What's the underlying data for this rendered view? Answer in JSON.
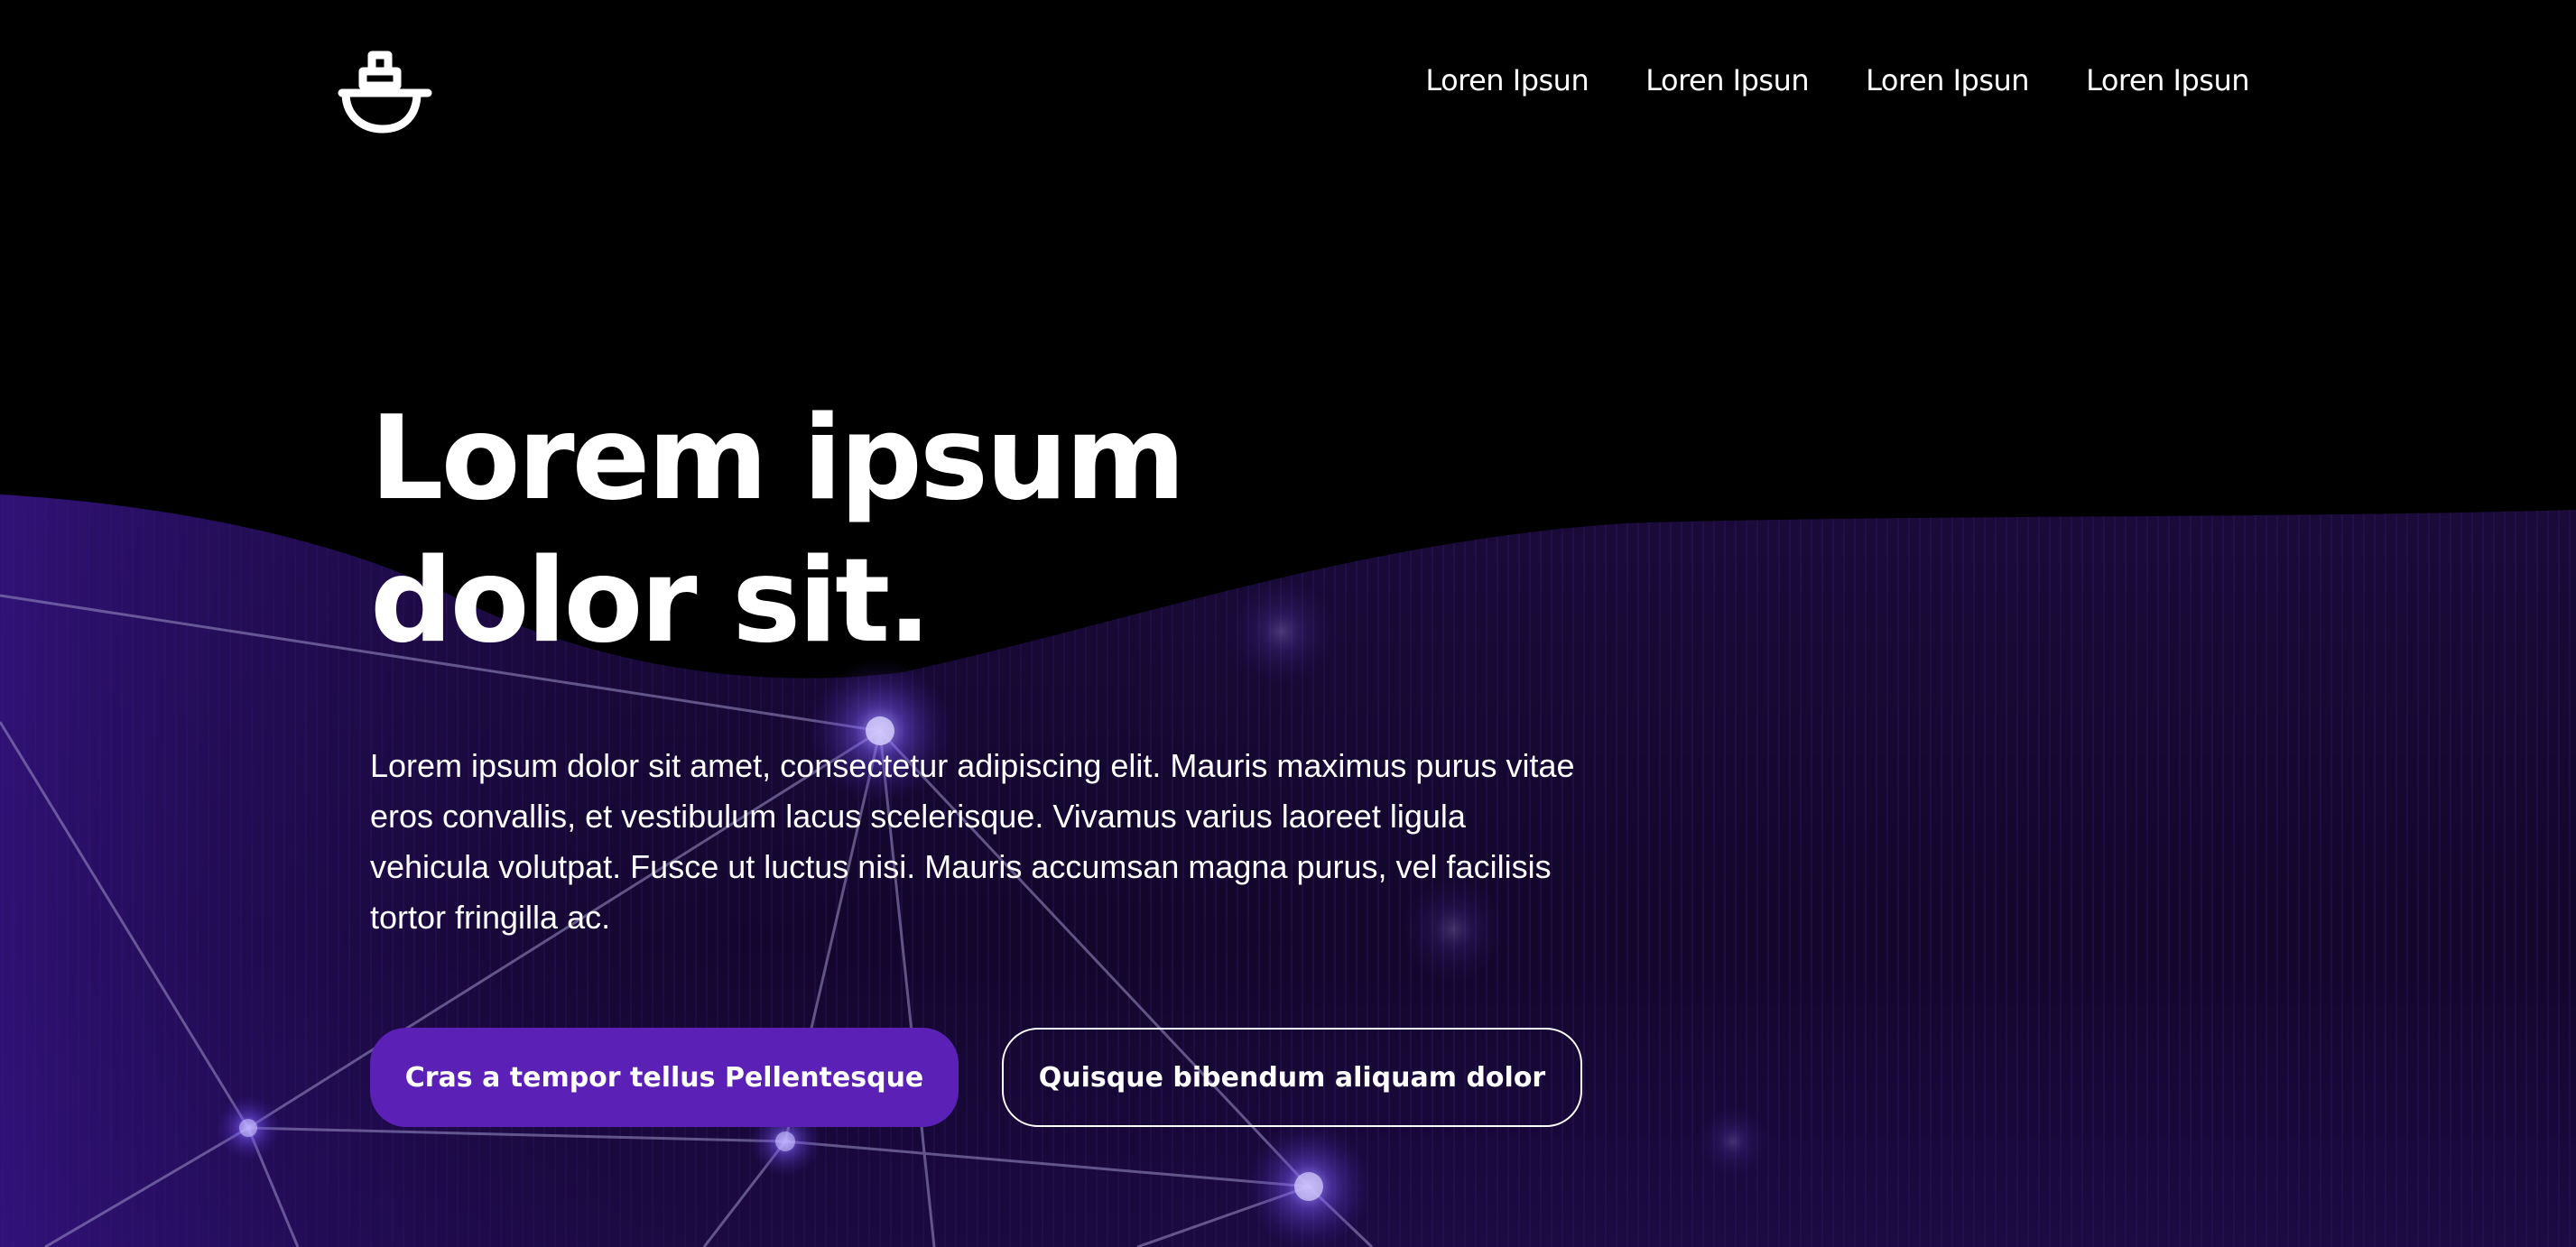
{
  "colors": {
    "accent": "#5b21b6",
    "background": "#000000",
    "text": "#ffffff"
  },
  "header": {
    "logo_icon": "ship-icon",
    "nav": [
      {
        "label": "Loren Ipsun"
      },
      {
        "label": "Loren Ipsun"
      },
      {
        "label": "Loren Ipsun"
      },
      {
        "label": "Loren Ipsun"
      }
    ]
  },
  "hero": {
    "title": "Lorem ipsum dolor sit.",
    "description": "Lorem ipsum dolor sit amet, consectetur adipiscing elit. Mauris maximus purus vitae eros convallis, et vestibulum lacus scelerisque. Vivamus varius laoreet ligula vehicula volutpat. Fusce ut luctus nisi. Mauris accumsan magna purus, vel facilisis tortor fringilla ac.",
    "primary_button": "Cras a tempor tellus Pellentesque",
    "secondary_button": "Quisque bibendum aliquam dolor"
  }
}
